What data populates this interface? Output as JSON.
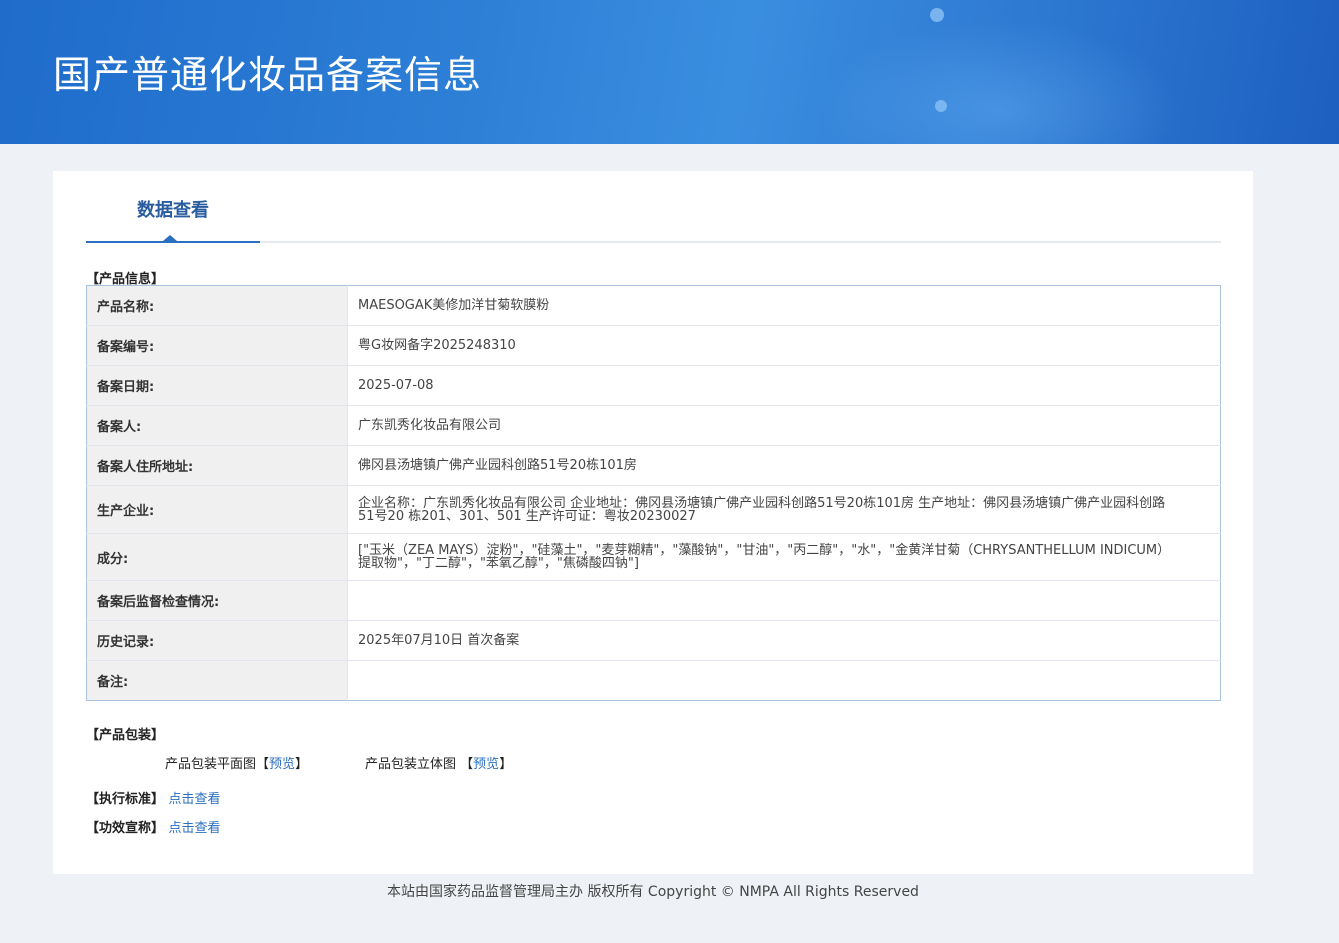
{
  "header": {
    "title": "国产普通化妆品备案信息"
  },
  "tabs": [
    {
      "label": "数据查看"
    }
  ],
  "product_info": {
    "section_title": "【产品信息】",
    "rows": [
      {
        "label": "产品名称:",
        "value": "MAESOGAK美修加洋甘菊软膜粉"
      },
      {
        "label": "备案编号:",
        "value": "粤G妆网备字2025248310"
      },
      {
        "label": "备案日期:",
        "value": "2025-07-08"
      },
      {
        "label": "备案人:",
        "value": "广东凯秀化妆品有限公司"
      },
      {
        "label": "备案人住所地址:",
        "value": "佛冈县汤塘镇广佛产业园科创路51号20栋101房"
      },
      {
        "label": "生产企业:",
        "value": "企业名称：广东凯秀化妆品有限公司 企业地址：佛冈县汤塘镇广佛产业园科创路51号20栋101房 生产地址：佛冈县汤塘镇广佛产业园科创路51号20 栋201、301、501 生产许可证：粤妆20230027"
      },
      {
        "label": "成分:",
        "value": "[\"玉米（ZEA MAYS）淀粉\"，\"硅藻土\"，\"麦芽糊精\"，\"藻酸钠\"，\"甘油\"，\"丙二醇\"，\"水\"，\"金黄洋甘菊（CHRYSANTHELLUM INDICUM）提取物\"，\"丁二醇\"，\"苯氧乙醇\"，\"焦磷酸四钠\"]"
      },
      {
        "label": "备案后监督检查情况:",
        "value": ""
      },
      {
        "label": "历史记录:",
        "value": "2025年07月10日 首次备案"
      },
      {
        "label": "备注:",
        "value": ""
      }
    ]
  },
  "packaging": {
    "section_title": "【产品包装】",
    "flat_label": "产品包装平面图",
    "flat_preview_open": "【",
    "flat_preview_link": "预览",
    "flat_preview_close": "】",
    "stereo_label": "产品包装立体图",
    "stereo_preview_open": "【",
    "stereo_preview_link": "预览",
    "stereo_preview_close": "】"
  },
  "standard": {
    "label": "【执行标准】",
    "link": "点击查看"
  },
  "efficacy": {
    "label": "【功效宣称】",
    "link": "点击查看"
  },
  "footer": {
    "text": "本站由国家药品监督管理局主办 版权所有 Copyright © NMPA All Rights Reserved"
  }
}
